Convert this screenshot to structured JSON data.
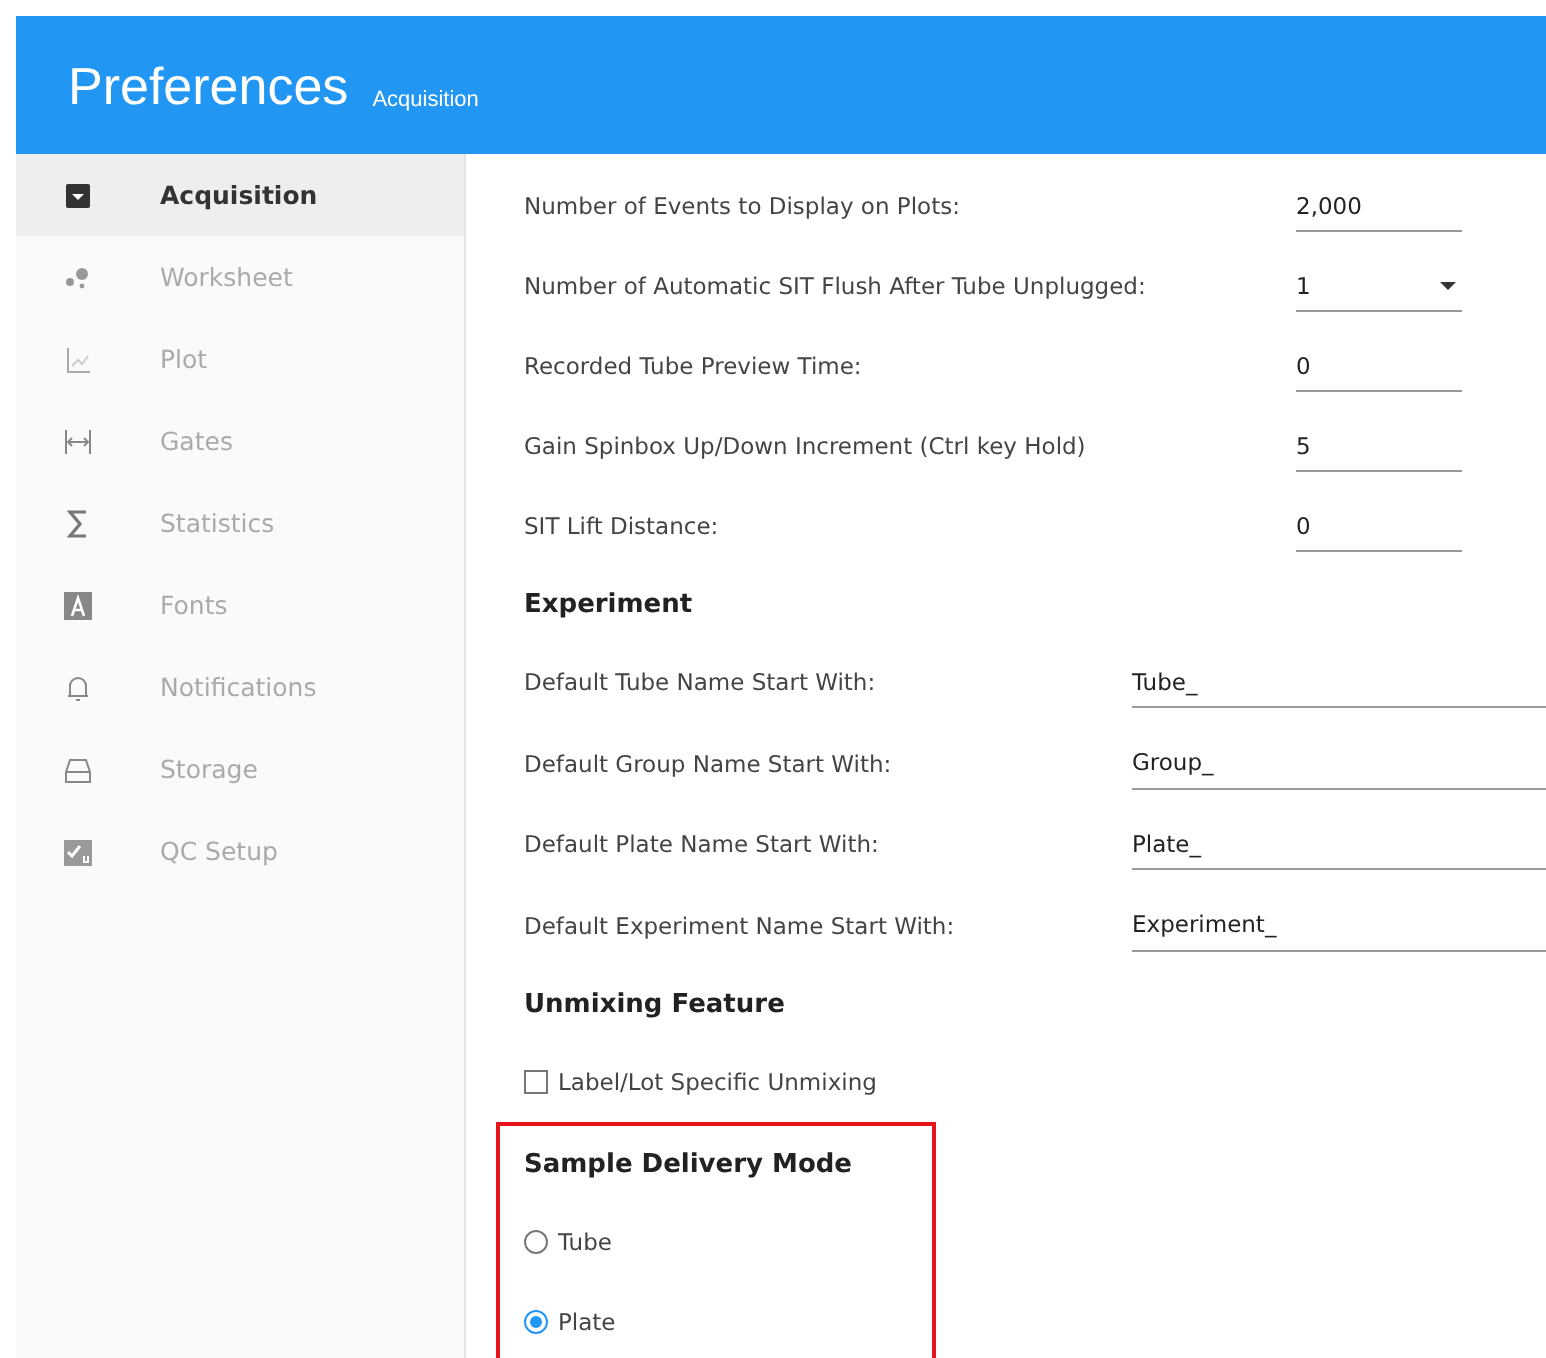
{
  "header": {
    "title": "Preferences",
    "subtitle": "Acquisition"
  },
  "sidebar": {
    "items": [
      {
        "label": "Acquisition",
        "selected": true
      },
      {
        "label": "Worksheet",
        "selected": false
      },
      {
        "label": "Plot",
        "selected": false
      },
      {
        "label": "Gates",
        "selected": false
      },
      {
        "label": "Statistics",
        "selected": false
      },
      {
        "label": "Fonts",
        "selected": false
      },
      {
        "label": "Notifications",
        "selected": false
      },
      {
        "label": "Storage",
        "selected": false
      },
      {
        "label": "QC Setup",
        "selected": false
      }
    ]
  },
  "settings": [
    {
      "kind": "input",
      "label": "Number of Events to Display on Plots:",
      "value": "2,000"
    },
    {
      "kind": "dropdown",
      "label": "Number of Automatic SIT Flush After Tube Unplugged:",
      "value": "1"
    },
    {
      "kind": "input",
      "label": "Recorded Tube Preview Time:",
      "value": "0"
    },
    {
      "kind": "input",
      "label": "Gain Spinbox Up/Down Increment (Ctrl key Hold)",
      "value": "5"
    },
    {
      "kind": "input",
      "label": "SIT Lift Distance:",
      "value": "0"
    }
  ],
  "experiment": {
    "heading": "Experiment",
    "fields": [
      {
        "label": "Default Tube Name Start With:",
        "value": "Tube_"
      },
      {
        "label": "Default Group Name Start With:",
        "value": "Group_"
      },
      {
        "label": "Default Plate Name Start With:",
        "value": "Plate_"
      },
      {
        "label": "Default Experiment Name Start With:",
        "value": "Experiment_"
      }
    ]
  },
  "unmixing": {
    "heading": "Unmixing Feature",
    "checkbox": {
      "label": "Label/Lot Specific Unmixing",
      "checked": false
    }
  },
  "sample_delivery": {
    "heading": "Sample Delivery Mode",
    "highlighted": true,
    "options": [
      {
        "label": "Tube",
        "selected": false
      },
      {
        "label": "Plate",
        "selected": true
      }
    ]
  }
}
